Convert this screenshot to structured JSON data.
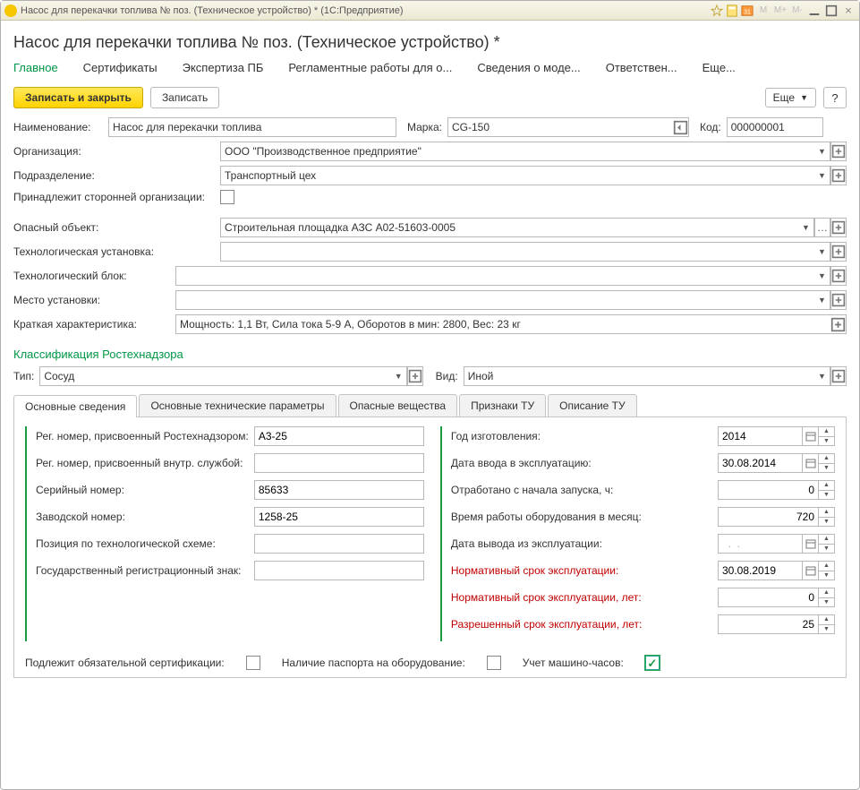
{
  "titlebar": {
    "text": "Насос для перекачки топлива № поз. (Техническое устройство) *  (1С:Предприятие)"
  },
  "page_title": "Насос для перекачки топлива № поз. (Техническое устройство) *",
  "topnav": {
    "main": "Главное",
    "certs": "Сертификаты",
    "expertise": "Экспертиза ПБ",
    "maintenance": "Регламентные работы для о...",
    "modinfo": "Сведения о моде...",
    "responsible": "Ответствен...",
    "more": "Еще..."
  },
  "toolbar": {
    "save_close": "Записать и закрыть",
    "save": "Записать",
    "more": "Еще",
    "help": "?"
  },
  "fields": {
    "name_label": "Наименование:",
    "name_value": "Насос для перекачки топлива",
    "brand_label": "Марка:",
    "brand_value": "CG-150",
    "code_label": "Код:",
    "code_value": "000000001",
    "org_label": "Организация:",
    "org_value": "ООО \"Производственное предприятие\"",
    "dept_label": "Подразделение:",
    "dept_value": "Транспортный цех",
    "external_org_label": "Принадлежит сторонней организации:",
    "danger_label": "Опасный объект:",
    "danger_value": "Строительная площадка АЗС А02-51603-0005",
    "techsetup_label": "Технологическая установка:",
    "techsetup_value": "",
    "techblock_label": "Технологический блок:",
    "techblock_value": "",
    "place_label": "Место установки:",
    "place_value": "",
    "desc_label": "Краткая характеристика:",
    "desc_value": "Мощность: 1,1 Вт, Сила тока 5-9 А, Оборотов в мин: 2800, Вес: 23 кг"
  },
  "classification": {
    "title": "Классификация Ростехнадзора",
    "type_label": "Тип:",
    "type_value": "Сосуд",
    "kind_label": "Вид:",
    "kind_value": "Иной"
  },
  "inner_tabs": {
    "t1": "Основные сведения",
    "t2": "Основные технические параметры",
    "t3": "Опасные вещества",
    "t4": "Признаки ТУ",
    "t5": "Описание ТУ"
  },
  "left": {
    "reg_rtn_label": "Рег. номер, присвоенный Ростехнадзором:",
    "reg_rtn_value": "А3-25",
    "reg_int_label": "Рег. номер, присвоенный внутр. службой:",
    "reg_int_value": "",
    "serial_label": "Серийный номер:",
    "serial_value": "85633",
    "factory_label": "Заводской номер:",
    "factory_value": "1258-25",
    "scheme_pos_label": "Позиция по технологической схеме:",
    "scheme_pos_value": "",
    "gosreg_label": "Государственный регистрационный знак:",
    "gosreg_value": ""
  },
  "right": {
    "mfg_year_label": "Год изготовления:",
    "mfg_year_value": "2014",
    "commission_label": "Дата ввода в эксплуатацию:",
    "commission_value": "30.08.2014",
    "worked_hours_label": "Отработано с начала запуска, ч:",
    "worked_hours_value": "0",
    "work_per_month_label": "Время работы оборудования в месяц:",
    "work_per_month_value": "720",
    "decommission_label": "Дата вывода из эксплуатации:",
    "decommission_value": "  .  .    ",
    "norm_date_label": "Нормативный срок эксплуатации:",
    "norm_date_value": "30.08.2019",
    "norm_years_label": "Нормативный срок эксплуатации, лет:",
    "norm_years_value": "0",
    "allowed_years_label": "Разрешенный срок эксплуатации, лет:",
    "allowed_years_value": "25"
  },
  "bottom": {
    "must_cert_label": "Подлежит обязательной сертификации:",
    "has_passport_label": "Наличие паспорта на оборудование:",
    "machine_hours_label": "Учет машино-часов:"
  }
}
